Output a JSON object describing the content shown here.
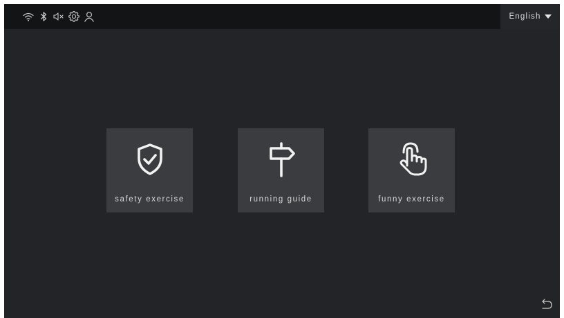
{
  "status_bar": {
    "icons": [
      "wifi-icon",
      "bluetooth-icon",
      "speaker-muted-icon",
      "settings-gear-icon",
      "user-icon"
    ]
  },
  "language_selector": {
    "selected": "English"
  },
  "tiles": [
    {
      "label": "safety exercise",
      "icon": "shield-check-icon"
    },
    {
      "label": "running guide",
      "icon": "signpost-icon"
    },
    {
      "label": "funny exercise",
      "icon": "tap-hand-icon"
    }
  ],
  "footer": {
    "back_icon": "back-arrow-icon"
  },
  "colors": {
    "background": "#222427",
    "topbar": "#131416",
    "tile": "#3a3c40",
    "text": "#d8d8d8"
  }
}
